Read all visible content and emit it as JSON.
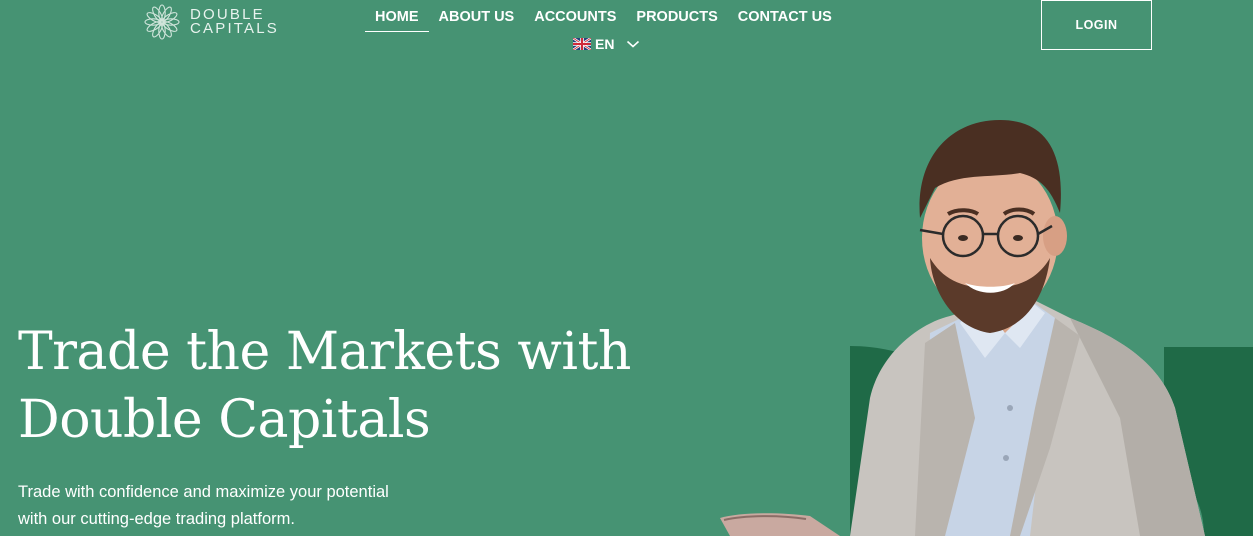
{
  "brand": {
    "name_line1": "DOUBLE",
    "name_line2": "CAPITALS"
  },
  "nav": {
    "items": [
      {
        "label": "HOME",
        "active": true
      },
      {
        "label": "ABOUT US",
        "active": false
      },
      {
        "label": "ACCOUNTS",
        "active": false
      },
      {
        "label": "PRODUCTS",
        "active": false
      },
      {
        "label": "CONTACT US",
        "active": false
      }
    ],
    "language": {
      "code": "EN",
      "flag_icon": "uk-flag-icon"
    }
  },
  "header": {
    "login_label": "LOGIN"
  },
  "hero": {
    "title_line1": "Trade the Markets with",
    "title_line2": "Double Capitals",
    "subtitle_line1": "Trade with confidence and maximize your potential",
    "subtitle_line2": "with our cutting-edge trading platform."
  },
  "colors": {
    "background": "#469373",
    "accent_dark": "#1f6a47",
    "text": "#ffffff"
  }
}
